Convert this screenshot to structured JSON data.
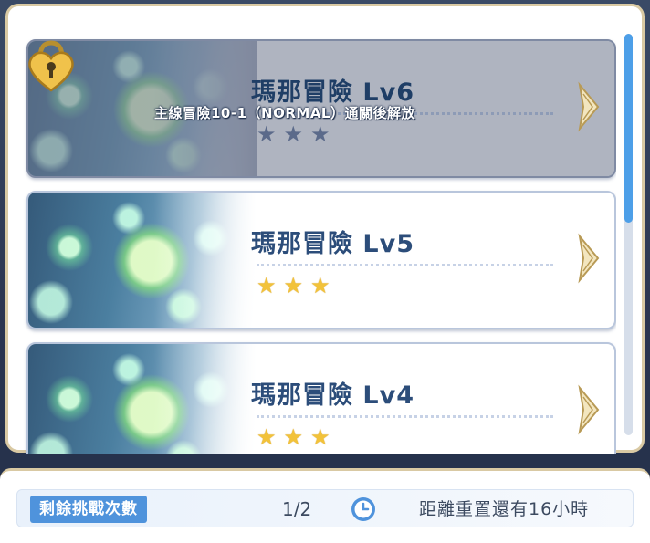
{
  "stages": [
    {
      "title": "瑪那冒險 Lv6",
      "locked": true,
      "lock_message": "主線冒險10-1（NORMAL）通關後解放",
      "stars_earned": 0,
      "stars_total": 3,
      "star_glyphs": [
        "★",
        "★",
        "★"
      ]
    },
    {
      "title": "瑪那冒險 Lv5",
      "locked": false,
      "stars_earned": 3,
      "stars_total": 3,
      "star_glyphs": [
        "★",
        "★",
        "★"
      ]
    },
    {
      "title": "瑪那冒險 Lv4",
      "locked": false,
      "stars_earned": 3,
      "stars_total": 3,
      "star_glyphs": [
        "★",
        "★",
        "★"
      ]
    }
  ],
  "icons": {
    "lock": "padlock-heart-icon",
    "arrow": "chevron-right-icon",
    "clock": "clock-icon",
    "star": "star-icon"
  },
  "scroll": {
    "position_fraction": 0.0,
    "visible_fraction": 0.47
  },
  "footer": {
    "remaining_label": "剩餘挑戰次數",
    "remaining_count": "1/2",
    "reset_text": "距離重置還有16小時"
  },
  "colors": {
    "title": "#2c4d7a",
    "star_gold": "#f2c23a",
    "star_locked": "#5b6a8a",
    "badge_blue": "#4f93dc",
    "scroll_blue": "#4d9fe8",
    "frame_gold": "#d9c9a3"
  }
}
